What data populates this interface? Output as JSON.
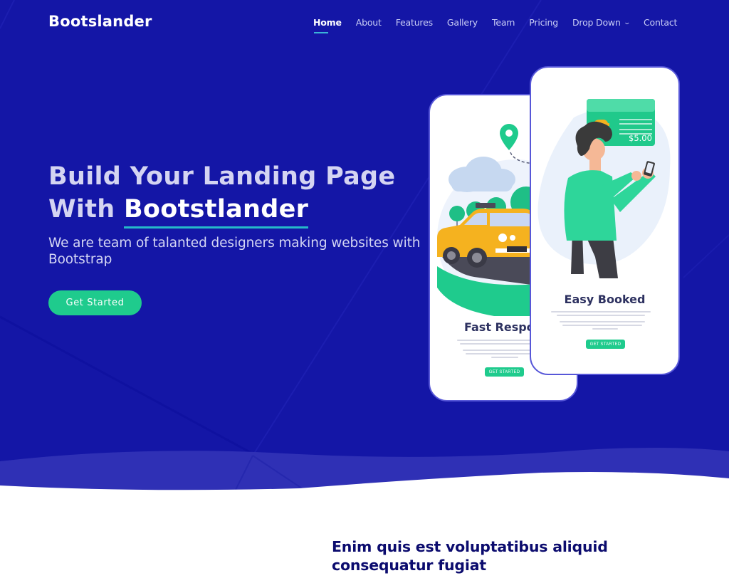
{
  "colors": {
    "hero_bg": "#1416a6",
    "accent_green": "#1fcb8d",
    "underline_cyan": "#25b9c9",
    "section_title": "#0b0b6e"
  },
  "header": {
    "logo": "Bootslander",
    "nav": [
      {
        "label": "Home",
        "active": true
      },
      {
        "label": "About"
      },
      {
        "label": "Features"
      },
      {
        "label": "Gallery"
      },
      {
        "label": "Team"
      },
      {
        "label": "Pricing"
      },
      {
        "label": "Drop Down",
        "icon": "chevron-down-icon"
      },
      {
        "label": "Contact"
      }
    ]
  },
  "hero": {
    "title_prefix_line1": "Build Your Landing Page",
    "title_prefix_line2": "With",
    "title_brand": "Bootstlander",
    "subtitle": "We are team of talanted designers making websites with Bootstrap",
    "cta_label": "Get Started",
    "phones": {
      "left": {
        "title": "Fast Respon",
        "button_label": "GET STARTED",
        "illustration": "taxi-with-location-pin"
      },
      "right": {
        "title": "Easy Booked",
        "button_label": "GET STARTED",
        "price": "$5.00",
        "illustration": "person-with-phone-and-receipt"
      }
    }
  },
  "section": {
    "title": "Enim quis est voluptatibus aliquid consequatur fugiat"
  }
}
